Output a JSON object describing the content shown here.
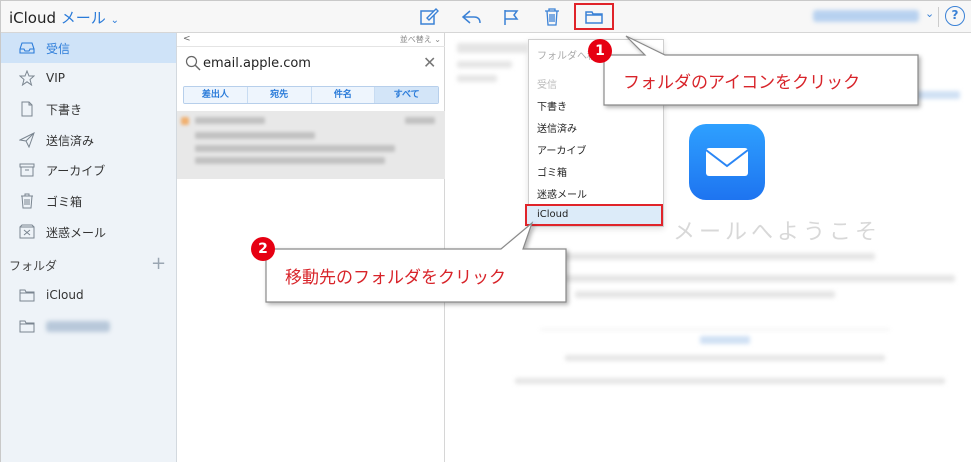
{
  "header": {
    "app_name": "iCloud",
    "app_section": "メール",
    "help_label": "?"
  },
  "sidebar": {
    "items": [
      {
        "label": "受信",
        "icon": "inbox-icon",
        "active": true
      },
      {
        "label": "VIP",
        "icon": "star-icon"
      },
      {
        "label": "下書き",
        "icon": "document-icon"
      },
      {
        "label": "送信済み",
        "icon": "paper-plane-icon"
      },
      {
        "label": "アーカイブ",
        "icon": "archive-box-icon"
      },
      {
        "label": "ゴミ箱",
        "icon": "trash-icon"
      },
      {
        "label": "迷惑メール",
        "icon": "junk-icon"
      }
    ],
    "section_label": "フォルダ",
    "folders": [
      {
        "label": "iCloud",
        "icon": "folder-icon"
      },
      {
        "label": "",
        "icon": "folder-icon"
      }
    ]
  },
  "list": {
    "back_label": "<",
    "sort_label": "並べ替え ⌄",
    "search_value": "email.apple.com",
    "filters": [
      "差出人",
      "宛先",
      "件名",
      "すべて"
    ]
  },
  "move_menu": {
    "header": "フォルダへ移",
    "items": [
      "受信",
      "下書き",
      "送信済み",
      "アーカイブ",
      "ゴミ箱",
      "迷惑メール",
      "iCloud"
    ]
  },
  "reading": {
    "welcome_text": "メールへようこそ"
  },
  "annotations": {
    "step1_number": "1",
    "step1_text": "フォルダのアイコンをクリック",
    "step2_number": "2",
    "step2_text": "移動先のフォルダをクリック",
    "accent_color": "#e0242a"
  },
  "colors": {
    "brand_blue": "#2a7bd9",
    "sidebar_bg": "#eef3f8",
    "active_bg": "#cfe3f8"
  }
}
